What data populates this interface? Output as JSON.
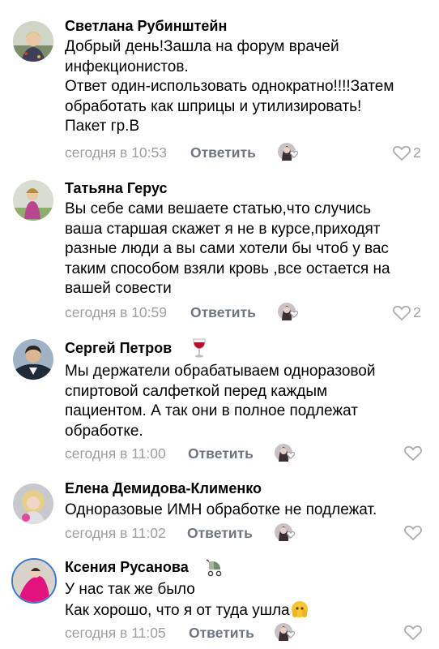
{
  "reply_label": "Ответить",
  "colors": {
    "date": "#9a9ea5",
    "reply": "#6e7581",
    "heart": "#a9adb3"
  },
  "comments": [
    {
      "author": "Светлана Рубинштейн",
      "lines": [
        "Добрый день!Зашла на форум врачей",
        "инфекционистов.",
        "Ответ один-использовать однократно!!!!Затем",
        "обработать как шприцы и утилизировать!",
        "Пакет гр.В"
      ],
      "date": "сегодня в 10:53",
      "likes": "2"
    },
    {
      "author": "Татьяна Герус",
      "lines": [
        "Вы себе сами вешаете статью,что случись",
        "ваша старшая скажет я не в курсе,приходят",
        "разные люди а вы сами хотели бы чтоб у вас",
        "таким способом взяли кровь ,все остается на",
        "вашей совести"
      ],
      "date": "сегодня в 10:59",
      "likes": "2"
    },
    {
      "author": "Сергей Петров",
      "badge_icon": "wine-glass-icon",
      "lines": [
        "Мы держатели обрабатываем одноразовой",
        "спиртовой салфеткой перед каждым",
        "пациентом. А так они в полное подлежат",
        "обработке."
      ],
      "date": "сегодня в 11:00",
      "likes": ""
    },
    {
      "author": "Елена Демидова-Клименко",
      "lines": [
        "Одноразовые ИМН обработке не подлежат."
      ],
      "date": "сегодня в 11:02",
      "likes": ""
    },
    {
      "author": "Ксения Русанова",
      "badge_icon": "stroller-icon",
      "lines": [
        "У нас так же было",
        "Как хорошо, что я от туда ушла"
      ],
      "trailing_emoji": "face-peeking-icon",
      "date": "сегодня в 11:05",
      "likes": ""
    }
  ]
}
